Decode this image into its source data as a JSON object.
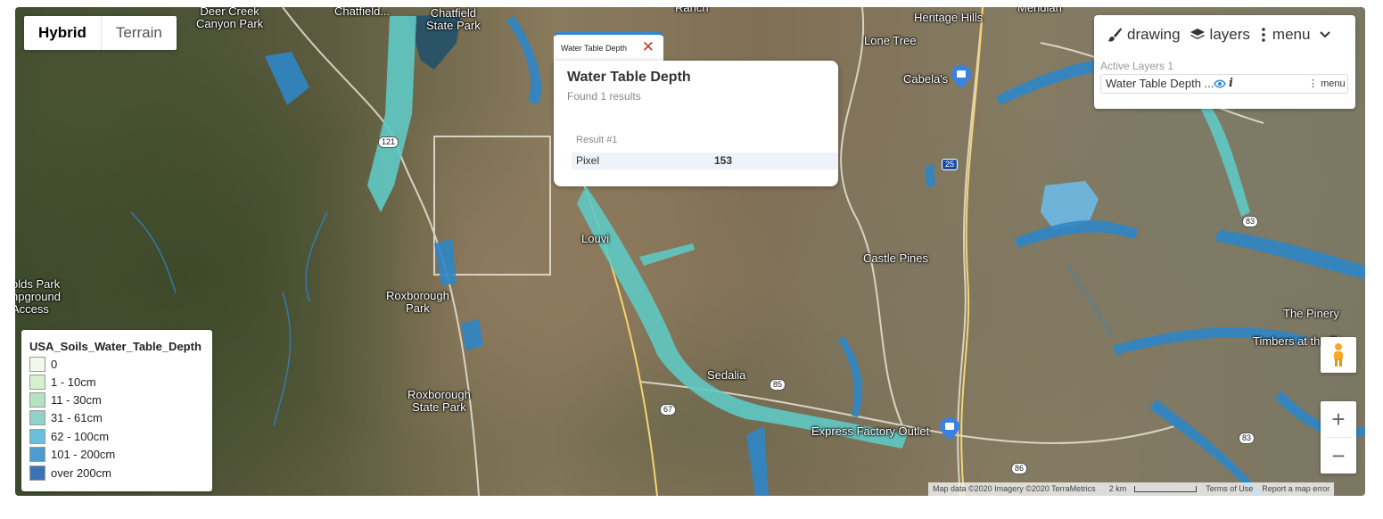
{
  "map_type": {
    "options": [
      "Hybrid",
      "Terrain"
    ],
    "selected": "Hybrid"
  },
  "places": {
    "deer_creek": "Deer Creek\nCanyon Park",
    "chatfield_left": "Chatfield...",
    "chatfield_sp": "Chatfield\nState Park",
    "ranch": "Ranch",
    "meridian": "Meridian",
    "heritage_hills": "Heritage Hills",
    "lone_tree": "Lone Tree",
    "cabelas": "Cabela's",
    "louviers": "Louvi",
    "castle_pines": "Castle Pines",
    "reynolds": "olds Park\nnpground\nAccess",
    "roxborough_park": "Roxborough\nPark",
    "roxborough_sp": "Roxborough\nState Park",
    "sedalia": "Sedalia",
    "express": "Express Factory Outlet",
    "the_pinery": "The Pinery",
    "timbers": "Timbers at the Pi"
  },
  "shields": {
    "r121": "121",
    "i25": "25",
    "r83a": "83",
    "r83b": "83",
    "r85": "85",
    "r67": "67",
    "r86": "86"
  },
  "popup": {
    "tab_label": "Water Table Depth",
    "title": "Water Table Depth",
    "subtitle": "Found 1 results",
    "result_label": "Result #1",
    "field_name": "Pixel",
    "field_value": "153"
  },
  "panel": {
    "drawing_label": "drawing",
    "layers_label": "layers",
    "menu_label": "menu",
    "active_layers_label": "Active Layers 1",
    "layer_name": "Water Table Depth ...",
    "info_glyph": "i",
    "layer_menu_label": "menu",
    "eye_icon": "eye-icon"
  },
  "legend": {
    "title": "USA_Soils_Water_Table_Depth",
    "entries": [
      {
        "label": "0",
        "color": "#f2f9ec"
      },
      {
        "label": "1 - 10cm",
        "color": "#d7f0cf"
      },
      {
        "label": "11 - 30cm",
        "color": "#b5e2c3"
      },
      {
        "label": "31 - 61cm",
        "color": "#8dd3c7"
      },
      {
        "label": "62 - 100cm",
        "color": "#6bbfdc"
      },
      {
        "label": "101 - 200cm",
        "color": "#4c9cd0"
      },
      {
        "label": "over 200cm",
        "color": "#3a74b4"
      }
    ]
  },
  "zoom": {
    "in": "+",
    "out": "−"
  },
  "attribution": {
    "map_data": "Map data ©2020 Imagery ©2020 TerraMetrics",
    "scale": "2 km",
    "terms": "Terms of Use",
    "report": "Report a map error"
  },
  "colors": {
    "water_shallow": "#5fc9c4",
    "water_deep": "#2f86c6",
    "accent": "#2c88d9",
    "close": "#c0392b"
  }
}
